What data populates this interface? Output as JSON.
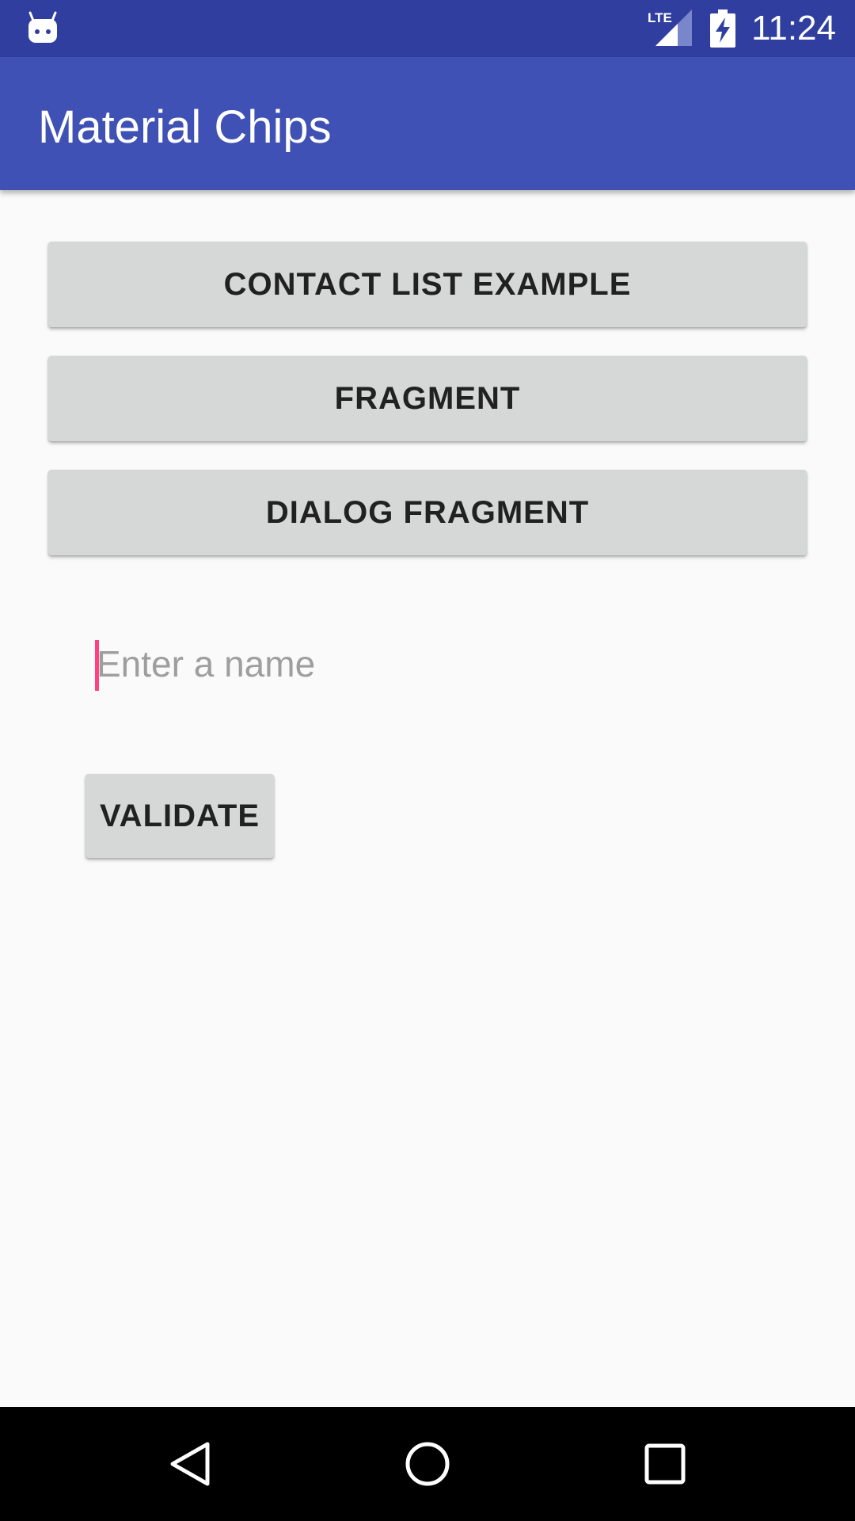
{
  "status_bar": {
    "time": "11:24",
    "network_label": "LTE",
    "icons": [
      "android-notification-icon",
      "lte-signal-icon",
      "battery-charging-icon"
    ]
  },
  "app_bar": {
    "title": "Material Chips",
    "color": "#3F51B5",
    "status_color": "#303F9F"
  },
  "main": {
    "buttons": {
      "contact_list": "CONTACT LIST EXAMPLE",
      "fragment": "FRAGMENT",
      "dialog_fragment": "DIALOG FRAGMENT"
    },
    "name_input": {
      "placeholder": "Enter a name",
      "value": "",
      "accent_color": "#FF4081"
    },
    "validate_label": "VALIDATE"
  },
  "nav_bar": {
    "icons": [
      "back-icon",
      "home-icon",
      "recents-icon"
    ]
  }
}
